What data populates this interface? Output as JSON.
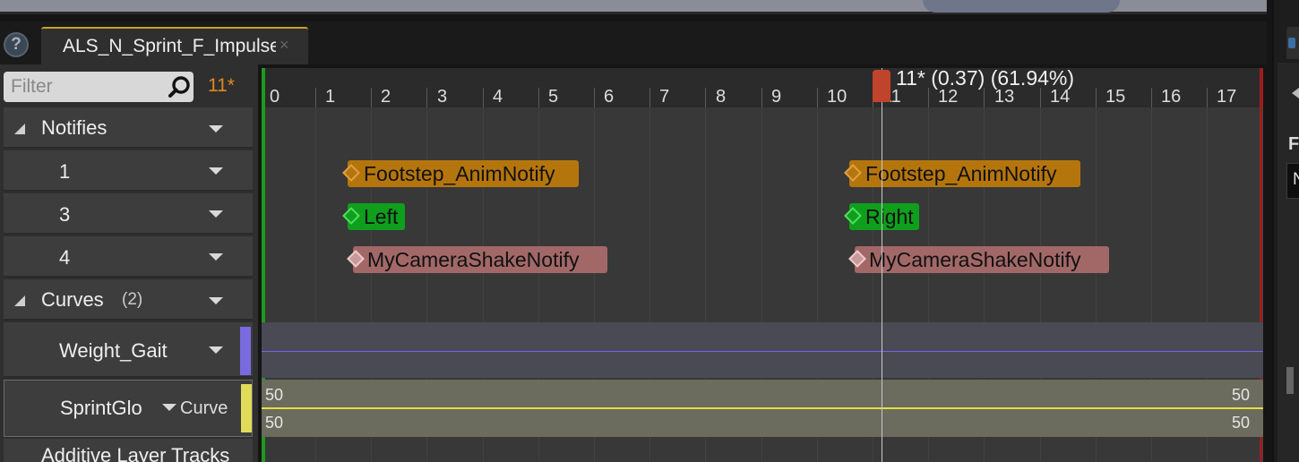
{
  "tab": {
    "title": "ALS_N_Sprint_F_Impulse",
    "close": "×"
  },
  "help": "?",
  "filter": {
    "placeholder": "Filter"
  },
  "frame_indicator": "11*",
  "tracks": {
    "notifies": {
      "label": "Notifies",
      "rows": [
        "1",
        "3",
        "4"
      ]
    },
    "curves": {
      "label": "Curves",
      "count": "(2)",
      "rows": [
        {
          "label": "Weight_Gait",
          "color": "#7a6ae0"
        },
        {
          "label": "SprintGlo",
          "sub": "Curve",
          "color": "#e0dc5a"
        }
      ]
    },
    "additive": {
      "label": "Additive Layer Tracks"
    }
  },
  "ruler": {
    "ticks": [
      "0",
      "1",
      "2",
      "3",
      "4",
      "5",
      "6",
      "7",
      "8",
      "9",
      "10",
      "11",
      "12",
      "13",
      "14",
      "15",
      "16",
      "17"
    ],
    "scrubber_label": "11* (0.37) (61.94%)"
  },
  "notifies": [
    {
      "label": "Footstep_AnimNotify",
      "color": "#b5750d"
    },
    {
      "label": "Footstep_AnimNotify",
      "color": "#b5750d"
    },
    {
      "label": "Left",
      "color": "#0f9f1d"
    },
    {
      "label": "Right",
      "color": "#0f9f1d"
    },
    {
      "label": "MyCameraShakeNotify",
      "color": "#a26868"
    },
    {
      "label": "MyCameraShakeNotify",
      "color": "#a26868"
    }
  ],
  "curve_values": {
    "top_left": "50",
    "top_right": "50",
    "bottom_left": "50",
    "bottom_right": "50"
  },
  "right_panel": {
    "letter": "F",
    "field": "N"
  }
}
